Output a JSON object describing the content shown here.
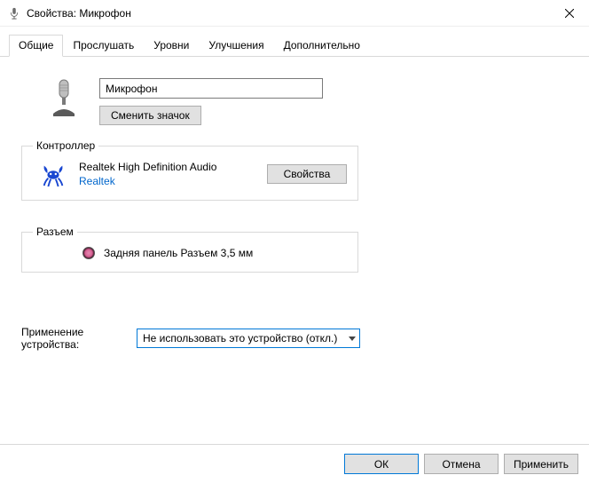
{
  "window": {
    "title": "Свойства: Микрофон"
  },
  "tabs": {
    "t0": "Общие",
    "t1": "Прослушать",
    "t2": "Уровни",
    "t3": "Улучшения",
    "t4": "Дополнительно"
  },
  "device": {
    "name": "Микрофон",
    "change_icon_label": "Сменить значок"
  },
  "controller": {
    "legend": "Контроллер",
    "name": "Realtek High Definition Audio",
    "vendor": "Realtek",
    "properties_label": "Свойства"
  },
  "jack": {
    "legend": "Разъем",
    "text": "Задняя панель Разъем 3,5 мм"
  },
  "usage": {
    "label": "Применение устройства:",
    "selected": "Не использовать это устройство (откл.)"
  },
  "footer": {
    "ok": "ОК",
    "cancel": "Отмена",
    "apply": "Применить"
  }
}
